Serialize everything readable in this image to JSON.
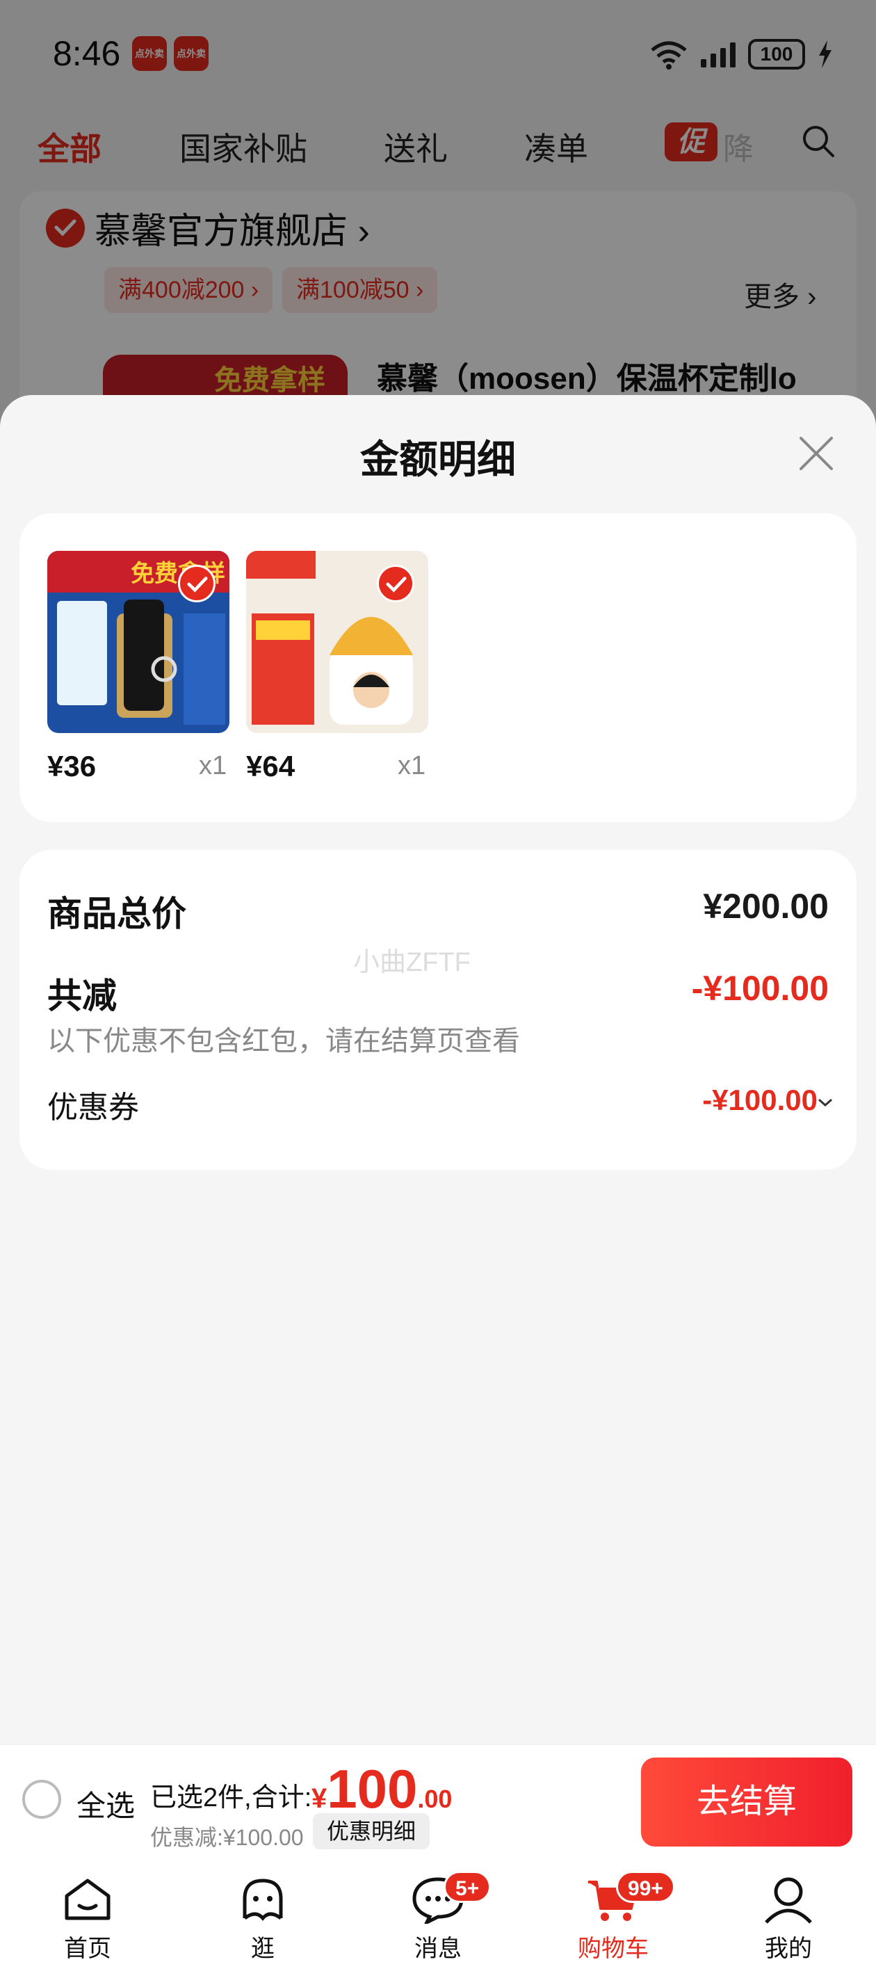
{
  "status_bar": {
    "time": "8:46",
    "notifications": [
      "点外卖",
      "点外卖"
    ],
    "network": "6",
    "battery": "100"
  },
  "top_tabs": [
    {
      "label": "全部",
      "active": true
    },
    {
      "label": "国家补贴",
      "active": false
    },
    {
      "label": "送礼",
      "active": false
    },
    {
      "label": "凑单",
      "active": false
    }
  ],
  "promo_tab": {
    "badge": "促",
    "label": "降"
  },
  "store": {
    "name": "慕馨官方旗舰店",
    "chips": [
      "满400减200",
      "满100减50"
    ],
    "more": "更多",
    "product_banner": "免费拿样",
    "product_title": "慕馨（moosen）保温杯定制lo"
  },
  "sheet": {
    "title": "金额明细",
    "items": [
      {
        "price": "¥36",
        "qty": "x1",
        "image": "thermos-gift-box"
      },
      {
        "price": "¥64",
        "qty": "x1",
        "image": "mug-with-straw"
      }
    ],
    "summary": {
      "total_label": "商品总价",
      "total_value": "¥200.00",
      "watermark": "小曲ZFTF",
      "reduce_label": "共减",
      "reduce_value": "-¥100.00",
      "reduce_note": "以下优惠不包含红包，请在结算页查看",
      "coupon_label": "优惠券",
      "coupon_value": "-¥100.00"
    }
  },
  "checkout_bar": {
    "select_all": "全选",
    "selected_text": "已选2件,合计:",
    "currency": "¥",
    "total_int": "100",
    "total_dec": ".00",
    "discount_text": "优惠减:¥100.00",
    "detail_button": "优惠明细",
    "checkout_button": "去结算"
  },
  "bottom_nav": [
    {
      "label": "首页",
      "icon": "home-icon",
      "active": false
    },
    {
      "label": "逛",
      "icon": "browse-icon",
      "active": false
    },
    {
      "label": "消息",
      "icon": "message-icon",
      "active": false,
      "badge": "5+"
    },
    {
      "label": "购物车",
      "icon": "cart-icon",
      "active": true,
      "badge": "99+"
    },
    {
      "label": "我的",
      "icon": "profile-icon",
      "active": false
    }
  ],
  "colors": {
    "accent": "#e52a1e",
    "background": "#f5f5f5"
  }
}
